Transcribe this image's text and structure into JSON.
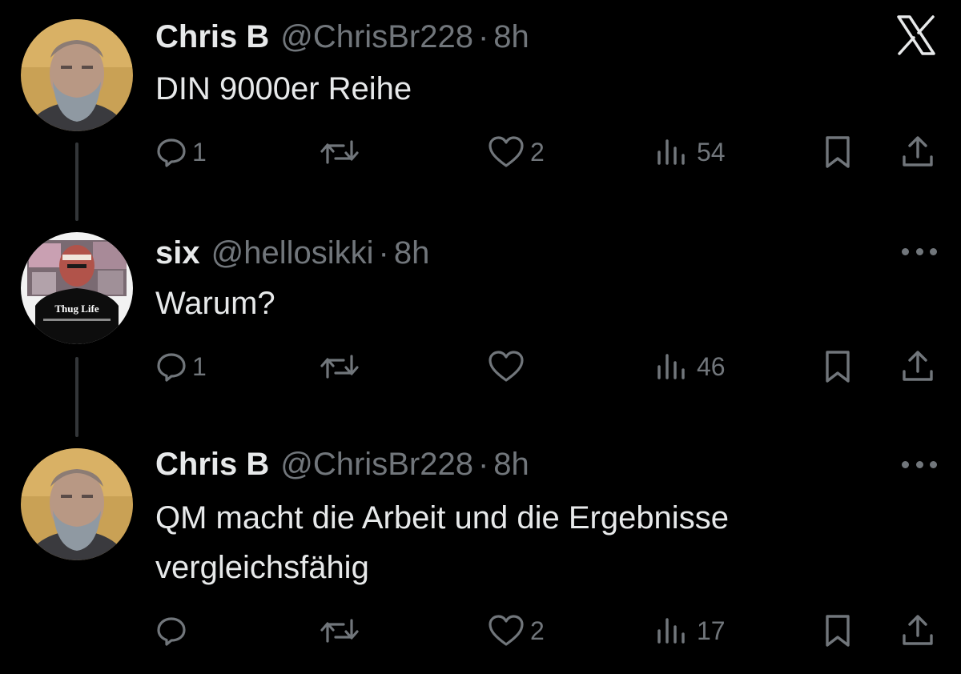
{
  "thread": {
    "tweets": [
      {
        "name": "Chris B",
        "handle": "@ChrisBr228",
        "separator": "·",
        "time": "8h",
        "text_lines": [
          "DIN 9000er Reihe"
        ],
        "replies": "1",
        "retweets": "",
        "likes": "2",
        "views": "54"
      },
      {
        "name": "six",
        "handle": "@hellosikki",
        "separator": "·",
        "time": "8h",
        "text_lines": [
          "Warum?"
        ],
        "replies": "1",
        "retweets": "",
        "likes": "",
        "views": "46",
        "avatar_shirt_text": "Thug Life"
      },
      {
        "name": "Chris B",
        "handle": "@ChrisBr228",
        "separator": "·",
        "time": "8h",
        "text_lines": [
          "QM macht die Arbeit und die Ergebnisse",
          "vergleichsfähig"
        ],
        "replies": "",
        "retweets": "",
        "likes": "2",
        "views": "17"
      }
    ]
  },
  "icons": {
    "close": "x-logo-close-icon",
    "reply": "reply-bubble-icon",
    "retweet": "retweet-arrows-icon",
    "like": "heart-icon",
    "views": "views-bar-chart-icon",
    "bookmark": "bookmark-icon",
    "share": "share-upload-icon",
    "more": "more-dots-icon"
  },
  "colors": {
    "background": "#000000",
    "text_primary": "#e7e9ea",
    "text_secondary": "#71767b",
    "thread_line": "#333639"
  }
}
